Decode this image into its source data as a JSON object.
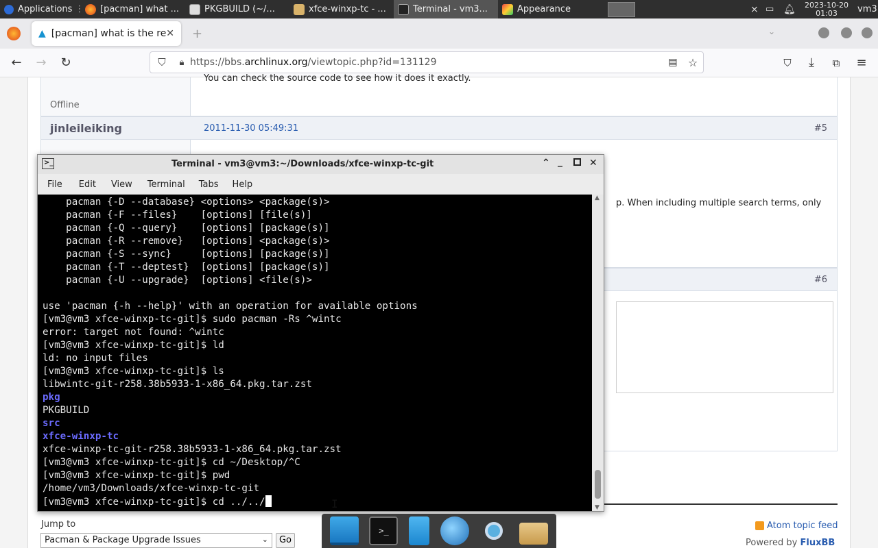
{
  "panel": {
    "applications": "Applications",
    "tasks": [
      {
        "label": "[pacman] what ..."
      },
      {
        "label": "PKGBUILD (~/..."
      },
      {
        "label": "xfce-winxp-tc - ..."
      },
      {
        "label": "Terminal - vm3..."
      },
      {
        "label": "Appearance"
      }
    ],
    "date": "2023-10-20",
    "time": "01:03",
    "user": "vm3"
  },
  "browser": {
    "tab_title": "[pacman] what is the re",
    "url_host_prefix": "https://bbs.",
    "url_host": "archlinux.org",
    "url_path": "/viewtopic.php?id=131129"
  },
  "forum": {
    "prev_text": "You can check the source code to see how it does it exactly.",
    "offline": "Offline",
    "post5": {
      "author": "jinleileiking",
      "date": "2011-11-30 05:49:31",
      "num": "#5"
    },
    "partial_body": "p. When including multiple search terms, only",
    "post6_num": "#6",
    "jump_to": "Jump to",
    "forum_select": "Pacman & Package Upgrade Issues",
    "go": "Go",
    "atom": "Atom topic feed",
    "powered_by": "Powered by",
    "fluxbb": "FluxBB"
  },
  "terminal": {
    "title": "Terminal - vm3@vm3:~/Downloads/xfce-winxp-tc-git",
    "menu": [
      "File",
      "Edit",
      "View",
      "Terminal",
      "Tabs",
      "Help"
    ],
    "lines": [
      {
        "text": "    pacman {-D --database} <options> <package(s)>"
      },
      {
        "text": "    pacman {-F --files}    [options] [file(s)]"
      },
      {
        "text": "    pacman {-Q --query}    [options] [package(s)]"
      },
      {
        "text": "    pacman {-R --remove}   [options] <package(s)>"
      },
      {
        "text": "    pacman {-S --sync}     [options] [package(s)]"
      },
      {
        "text": "    pacman {-T --deptest}  [options] [package(s)]"
      },
      {
        "text": "    pacman {-U --upgrade}  [options] <file(s)>"
      },
      {
        "text": ""
      },
      {
        "text": "use 'pacman {-h --help}' with an operation for available options"
      },
      {
        "text": "[vm3@vm3 xfce-winxp-tc-git]$ sudo pacman -Rs ^wintc"
      },
      {
        "text": "error: target not found: ^wintc"
      },
      {
        "text": "[vm3@vm3 xfce-winxp-tc-git]$ ld"
      },
      {
        "text": "ld: no input files"
      },
      {
        "text": "[vm3@vm3 xfce-winxp-tc-git]$ ls"
      },
      {
        "text": "libwintc-git-r258.38b5933-1-x86_64.pkg.tar.zst"
      },
      {
        "text": "pkg",
        "dir": true
      },
      {
        "text": "PKGBUILD"
      },
      {
        "text": "src",
        "dir": true
      },
      {
        "text": "xfce-winxp-tc",
        "dir": true
      },
      {
        "text": "xfce-winxp-tc-git-r258.38b5933-1-x86_64.pkg.tar.zst"
      },
      {
        "text": "[vm3@vm3 xfce-winxp-tc-git]$ cd ~/Desktop/^C"
      },
      {
        "text": "[vm3@vm3 xfce-winxp-tc-git]$ pwd"
      },
      {
        "text": "/home/vm3/Downloads/xfce-winxp-tc-git"
      },
      {
        "text": "[vm3@vm3 xfce-winxp-tc-git]$ cd ../../",
        "cursor": true
      }
    ]
  },
  "dock": [
    "desktop-icon",
    "terminal-icon",
    "file-manager-icon",
    "web-browser-icon",
    "app-finder-icon",
    "folder-icon"
  ]
}
